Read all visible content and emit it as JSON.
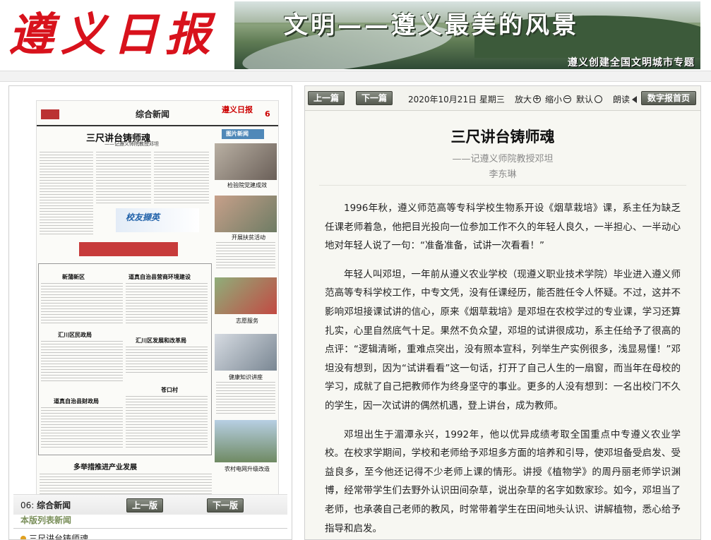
{
  "header": {
    "logo_text": "遵义日报",
    "banner_title": "文明——遵义最美的风景",
    "banner_subtitle": "遵义创建全国文明城市专题"
  },
  "left_panel": {
    "thumbnail": {
      "section": "综合新闻",
      "brand": "遵义日报",
      "page_no": "6",
      "headline": "三尺讲台铸师魂",
      "subheadline": "——记遵义师院教授邓坦",
      "pic_news": "图片新闻",
      "ad_text": "校友撷英",
      "sub_heads": [
        "新蒲新区",
        "道真自治县营商环境建设",
        "汇川区民政局",
        "汇川区发展和改革局",
        "道真自治县财政局",
        "苍口村",
        "多举措推进产业发展"
      ],
      "photo_captions": [
        "检验院党建成效",
        "开展扶贫活动",
        "志愿服务",
        "健康知识讲座",
        "农村电网升级改造"
      ]
    },
    "page_label_no": "06:",
    "page_label_name": "综合新闻",
    "prev_page": "上一版",
    "next_page": "下一版",
    "list_title": "本版列表新闻",
    "list_items": [
      "三尺讲台铸师魂"
    ]
  },
  "toolbar": {
    "prev_article": "上一篇",
    "next_article": "下一篇",
    "date": "2020年10月21日 星期三",
    "zoom_in": "放大",
    "zoom_out": "缩小",
    "zoom_default": "默认",
    "read": "朗读",
    "home": "数字报首页"
  },
  "article": {
    "title": "三尺讲台铸师魂",
    "subtitle": "——记遵义师院教授邓坦",
    "author": "李东琳",
    "paragraphs": [
      "1996年秋，遵义师范高等专科学校生物系开设《烟草栽培》课，系主任为缺乏任课老师着急，他把目光投向一位参加工作不久的年轻人良久，一半担心、一半动心地对年轻人说了一句：“准备准备，试讲一次看看！”",
      "年轻人叫邓坦，一年前从遵义农业学校（现遵义职业技术学院）毕业进入遵义师范高等专科学校工作，中专文凭，没有任课经历，能否胜任令人怀疑。不过，这并不影响邓坦接课试讲的信心，原来《烟草栽培》是邓坦在农校学过的专业课，学习还算扎实，心里自然底气十足。果然不负众望，邓坦的试讲很成功，系主任给予了很高的点评：“逻辑清晰，重难点突出，没有照本宣科，列举生产实例很多，浅显易懂！”邓坦没有想到，因为“试讲看看”这一句话，打开了自己人生的一扇窗，而当年在母校的学习，成就了自己把教师作为终身坚守的事业。更多的人没有想到：一名出校门不久的学生，因一次试讲的偶然机遇，登上讲台，成为教师。",
      "邓坦出生于湄潭永兴，1992年，他以优异成绩考取全国重点中专遵义农业学校。在校求学期间，学校和老师给予邓坦多方面的培养和引导，使邓坦备受启发、受益良多，至今他还记得不少老师上课的情形。讲授《植物学》的周丹丽老师学识渊博，经常带学生们去野外认识田间杂草，说出杂草的名字如数家珍。如今，邓坦当了老师，也承袭自己老师的教风，时常带着学生在田间地头认识、讲解植物，悉心给予指导和启发。"
    ]
  }
}
